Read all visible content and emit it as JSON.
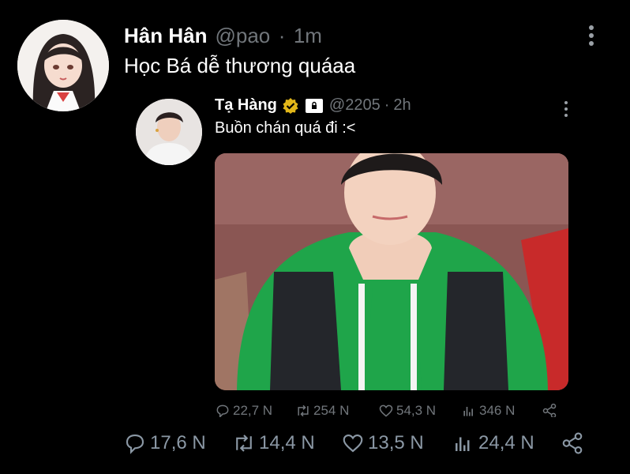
{
  "tweet": {
    "author_name": "Hân Hân",
    "handle": "@pao",
    "separator": "·",
    "time": "1m",
    "text": "Học Bá dễ thương quáaa",
    "actions": {
      "replies": "17,6 N",
      "retweets": "14,4 N",
      "likes": "13,5 N",
      "views": "24,4 N"
    }
  },
  "quoted": {
    "author_name": "Tạ Hàng",
    "handle": "@2205",
    "separator": "·",
    "time": "2h",
    "text": "Buồn chán quá đi :<",
    "actions": {
      "replies": "22,7 N",
      "retweets": "254 N",
      "likes": "54,3 N",
      "views": "346 N"
    }
  },
  "icons": {
    "verified_badge": "gold-check-icon",
    "protected": "lock-icon"
  },
  "colors": {
    "background": "#000000",
    "muted": "#71767b",
    "verified": "#e2b719"
  }
}
